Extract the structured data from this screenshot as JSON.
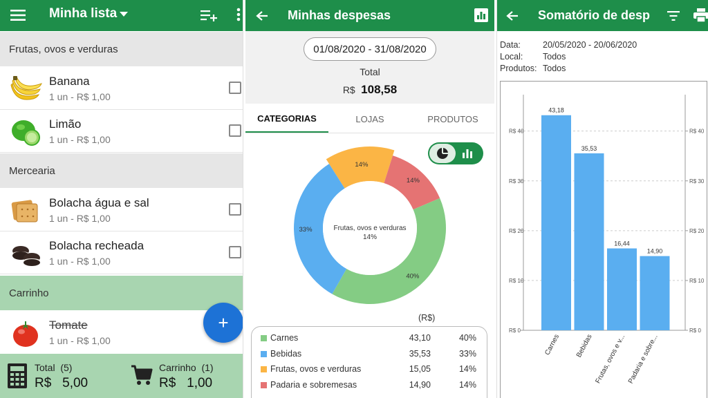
{
  "list_screen": {
    "title": "Minha lista",
    "sections": [
      {
        "label": "Frutas, ovos e verduras"
      },
      {
        "label": "Mercearia"
      },
      {
        "label": "Carrinho"
      }
    ],
    "items": [
      {
        "name": "Banana",
        "detail": "1 un - R$ 1,00"
      },
      {
        "name": "Limão",
        "detail": "1 un - R$ 1,00"
      },
      {
        "name": "Bolacha água e sal",
        "detail": "1 un - R$ 1,00"
      },
      {
        "name": "Bolacha recheada",
        "detail": "1 un - R$ 1,00"
      },
      {
        "name": "Tomate",
        "detail": "1 un - R$ 1,00"
      }
    ],
    "fab_label": "+",
    "total_label": "Total  (5)",
    "total_value": "R$   5,00",
    "cart_label": "Carrinho  (1)",
    "cart_value": "R$   1,00"
  },
  "expenses_screen": {
    "title": "Minhas despesas",
    "date_range": "01/08/2020 - 31/08/2020",
    "total_label": "Total",
    "total_currency": "R$",
    "total_value": "108,58",
    "tabs": [
      "CATEGORIAS",
      "LOJAS",
      "PRODUTOS"
    ],
    "active_tab": "CATEGORIAS",
    "donut_center": [
      "Frutas, ovos e verduras",
      "14%"
    ],
    "legend_unit": "(R$)",
    "legend": [
      {
        "label": "Carnes",
        "value": "43,10",
        "pct": "40%",
        "color": "#84cc84"
      },
      {
        "label": "Bebidas",
        "value": "35,53",
        "pct": "33%",
        "color": "#5aaef0"
      },
      {
        "label": "Frutas, ovos e verduras",
        "value": "15,05",
        "pct": "14%",
        "color": "#fbb545"
      },
      {
        "label": "Padaria e sobremesas",
        "value": "14,90",
        "pct": "14%",
        "color": "#e57373"
      }
    ]
  },
  "sum_screen": {
    "title": "Somatório de desp",
    "filters": [
      {
        "label": "Data:",
        "value": "20/05/2020 - 20/06/2020"
      },
      {
        "label": "Local:",
        "value": "Todos"
      },
      {
        "label": "Produtos:",
        "value": "Todos"
      }
    ]
  },
  "chart_data": [
    {
      "type": "pie",
      "categories": [
        "Carnes",
        "Bebidas",
        "Frutas, ovos e verduras",
        "Padaria e sobremesas"
      ],
      "values": [
        43.1,
        35.53,
        15.05,
        14.9
      ],
      "labels": [
        "40%",
        "33%",
        "14%",
        "14%"
      ],
      "colors": [
        "#84cc84",
        "#5aaef0",
        "#fbb545",
        "#e57373"
      ]
    },
    {
      "type": "bar",
      "categories": [
        "Carnes",
        "Bebidas",
        "Frutas, ovos e v...",
        "Padaria e sobre..."
      ],
      "values": [
        43.18,
        35.53,
        16.44,
        14.9
      ],
      "value_labels": [
        "43,18",
        "35,53",
        "16,44",
        "14,90"
      ],
      "yticks": [
        "R$ 0",
        "R$ 10",
        "R$ 20",
        "R$ 30",
        "R$ 40"
      ],
      "ylim": [
        0,
        48
      ],
      "grid": true,
      "color": "#5aaef0"
    }
  ]
}
